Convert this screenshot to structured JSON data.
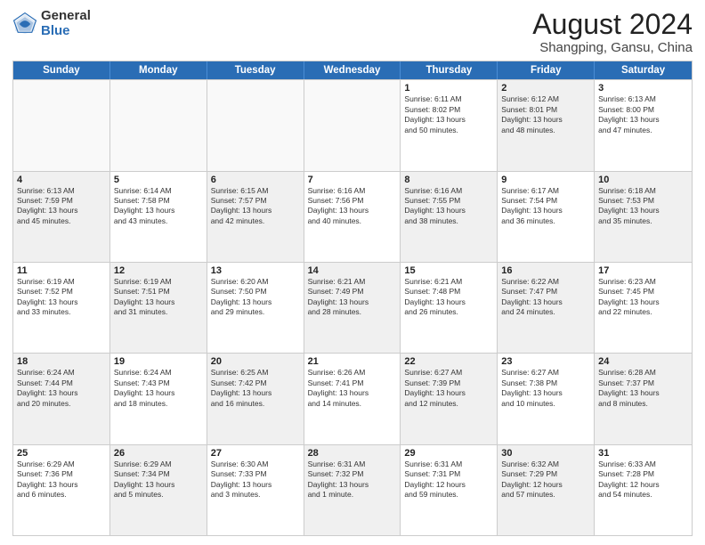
{
  "logo": {
    "general": "General",
    "blue": "Blue"
  },
  "title": {
    "month_year": "August 2024",
    "location": "Shangping, Gansu, China"
  },
  "header_days": [
    "Sunday",
    "Monday",
    "Tuesday",
    "Wednesday",
    "Thursday",
    "Friday",
    "Saturday"
  ],
  "weeks": [
    [
      {
        "day": "",
        "info": "",
        "shaded": true
      },
      {
        "day": "",
        "info": "",
        "shaded": true
      },
      {
        "day": "",
        "info": "",
        "shaded": true
      },
      {
        "day": "",
        "info": "",
        "shaded": true
      },
      {
        "day": "1",
        "info": "Sunrise: 6:11 AM\nSunset: 8:02 PM\nDaylight: 13 hours\nand 50 minutes.",
        "shaded": false
      },
      {
        "day": "2",
        "info": "Sunrise: 6:12 AM\nSunset: 8:01 PM\nDaylight: 13 hours\nand 48 minutes.",
        "shaded": true
      },
      {
        "day": "3",
        "info": "Sunrise: 6:13 AM\nSunset: 8:00 PM\nDaylight: 13 hours\nand 47 minutes.",
        "shaded": false
      }
    ],
    [
      {
        "day": "4",
        "info": "Sunrise: 6:13 AM\nSunset: 7:59 PM\nDaylight: 13 hours\nand 45 minutes.",
        "shaded": true
      },
      {
        "day": "5",
        "info": "Sunrise: 6:14 AM\nSunset: 7:58 PM\nDaylight: 13 hours\nand 43 minutes.",
        "shaded": false
      },
      {
        "day": "6",
        "info": "Sunrise: 6:15 AM\nSunset: 7:57 PM\nDaylight: 13 hours\nand 42 minutes.",
        "shaded": true
      },
      {
        "day": "7",
        "info": "Sunrise: 6:16 AM\nSunset: 7:56 PM\nDaylight: 13 hours\nand 40 minutes.",
        "shaded": false
      },
      {
        "day": "8",
        "info": "Sunrise: 6:16 AM\nSunset: 7:55 PM\nDaylight: 13 hours\nand 38 minutes.",
        "shaded": true
      },
      {
        "day": "9",
        "info": "Sunrise: 6:17 AM\nSunset: 7:54 PM\nDaylight: 13 hours\nand 36 minutes.",
        "shaded": false
      },
      {
        "day": "10",
        "info": "Sunrise: 6:18 AM\nSunset: 7:53 PM\nDaylight: 13 hours\nand 35 minutes.",
        "shaded": true
      }
    ],
    [
      {
        "day": "11",
        "info": "Sunrise: 6:19 AM\nSunset: 7:52 PM\nDaylight: 13 hours\nand 33 minutes.",
        "shaded": false
      },
      {
        "day": "12",
        "info": "Sunrise: 6:19 AM\nSunset: 7:51 PM\nDaylight: 13 hours\nand 31 minutes.",
        "shaded": true
      },
      {
        "day": "13",
        "info": "Sunrise: 6:20 AM\nSunset: 7:50 PM\nDaylight: 13 hours\nand 29 minutes.",
        "shaded": false
      },
      {
        "day": "14",
        "info": "Sunrise: 6:21 AM\nSunset: 7:49 PM\nDaylight: 13 hours\nand 28 minutes.",
        "shaded": true
      },
      {
        "day": "15",
        "info": "Sunrise: 6:21 AM\nSunset: 7:48 PM\nDaylight: 13 hours\nand 26 minutes.",
        "shaded": false
      },
      {
        "day": "16",
        "info": "Sunrise: 6:22 AM\nSunset: 7:47 PM\nDaylight: 13 hours\nand 24 minutes.",
        "shaded": true
      },
      {
        "day": "17",
        "info": "Sunrise: 6:23 AM\nSunset: 7:45 PM\nDaylight: 13 hours\nand 22 minutes.",
        "shaded": false
      }
    ],
    [
      {
        "day": "18",
        "info": "Sunrise: 6:24 AM\nSunset: 7:44 PM\nDaylight: 13 hours\nand 20 minutes.",
        "shaded": true
      },
      {
        "day": "19",
        "info": "Sunrise: 6:24 AM\nSunset: 7:43 PM\nDaylight: 13 hours\nand 18 minutes.",
        "shaded": false
      },
      {
        "day": "20",
        "info": "Sunrise: 6:25 AM\nSunset: 7:42 PM\nDaylight: 13 hours\nand 16 minutes.",
        "shaded": true
      },
      {
        "day": "21",
        "info": "Sunrise: 6:26 AM\nSunset: 7:41 PM\nDaylight: 13 hours\nand 14 minutes.",
        "shaded": false
      },
      {
        "day": "22",
        "info": "Sunrise: 6:27 AM\nSunset: 7:39 PM\nDaylight: 13 hours\nand 12 minutes.",
        "shaded": true
      },
      {
        "day": "23",
        "info": "Sunrise: 6:27 AM\nSunset: 7:38 PM\nDaylight: 13 hours\nand 10 minutes.",
        "shaded": false
      },
      {
        "day": "24",
        "info": "Sunrise: 6:28 AM\nSunset: 7:37 PM\nDaylight: 13 hours\nand 8 minutes.",
        "shaded": true
      }
    ],
    [
      {
        "day": "25",
        "info": "Sunrise: 6:29 AM\nSunset: 7:36 PM\nDaylight: 13 hours\nand 6 minutes.",
        "shaded": false
      },
      {
        "day": "26",
        "info": "Sunrise: 6:29 AM\nSunset: 7:34 PM\nDaylight: 13 hours\nand 5 minutes.",
        "shaded": true
      },
      {
        "day": "27",
        "info": "Sunrise: 6:30 AM\nSunset: 7:33 PM\nDaylight: 13 hours\nand 3 minutes.",
        "shaded": false
      },
      {
        "day": "28",
        "info": "Sunrise: 6:31 AM\nSunset: 7:32 PM\nDaylight: 13 hours\nand 1 minute.",
        "shaded": true
      },
      {
        "day": "29",
        "info": "Sunrise: 6:31 AM\nSunset: 7:31 PM\nDaylight: 12 hours\nand 59 minutes.",
        "shaded": false
      },
      {
        "day": "30",
        "info": "Sunrise: 6:32 AM\nSunset: 7:29 PM\nDaylight: 12 hours\nand 57 minutes.",
        "shaded": true
      },
      {
        "day": "31",
        "info": "Sunrise: 6:33 AM\nSunset: 7:28 PM\nDaylight: 12 hours\nand 54 minutes.",
        "shaded": false
      }
    ]
  ]
}
